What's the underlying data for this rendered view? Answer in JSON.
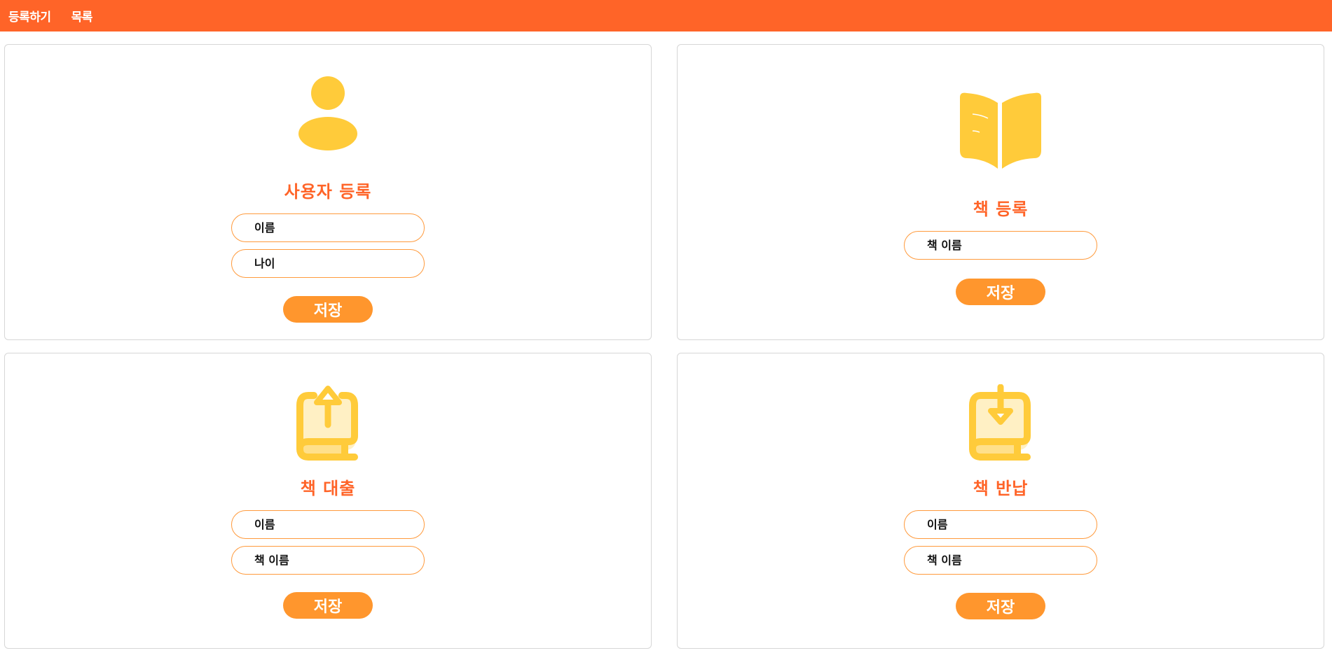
{
  "nav": {
    "items": [
      {
        "label": "등록하기"
      },
      {
        "label": "목록"
      }
    ]
  },
  "colors": {
    "header": "#ff6428",
    "accent_title": "#ff6428",
    "button": "#ff962d",
    "field_border": "#ff9a3c",
    "icon": "#ffcb3a"
  },
  "cards": {
    "user": {
      "icon": "user-icon",
      "title": "사용자 등록",
      "name_placeholder": "이름",
      "age_placeholder": "나이",
      "save_label": "저장"
    },
    "book": {
      "icon": "open-book-icon",
      "title": "책 등록",
      "book_name_placeholder": "책 이름",
      "save_label": "저장"
    },
    "loan": {
      "icon": "book-upload-icon",
      "title": "책 대출",
      "name_placeholder": "이름",
      "book_name_placeholder": "책 이름",
      "save_label": "저장"
    },
    "return": {
      "icon": "book-download-icon",
      "title": "책 반납",
      "name_placeholder": "이름",
      "book_name_placeholder": "책 이름",
      "save_label": "저장"
    }
  }
}
